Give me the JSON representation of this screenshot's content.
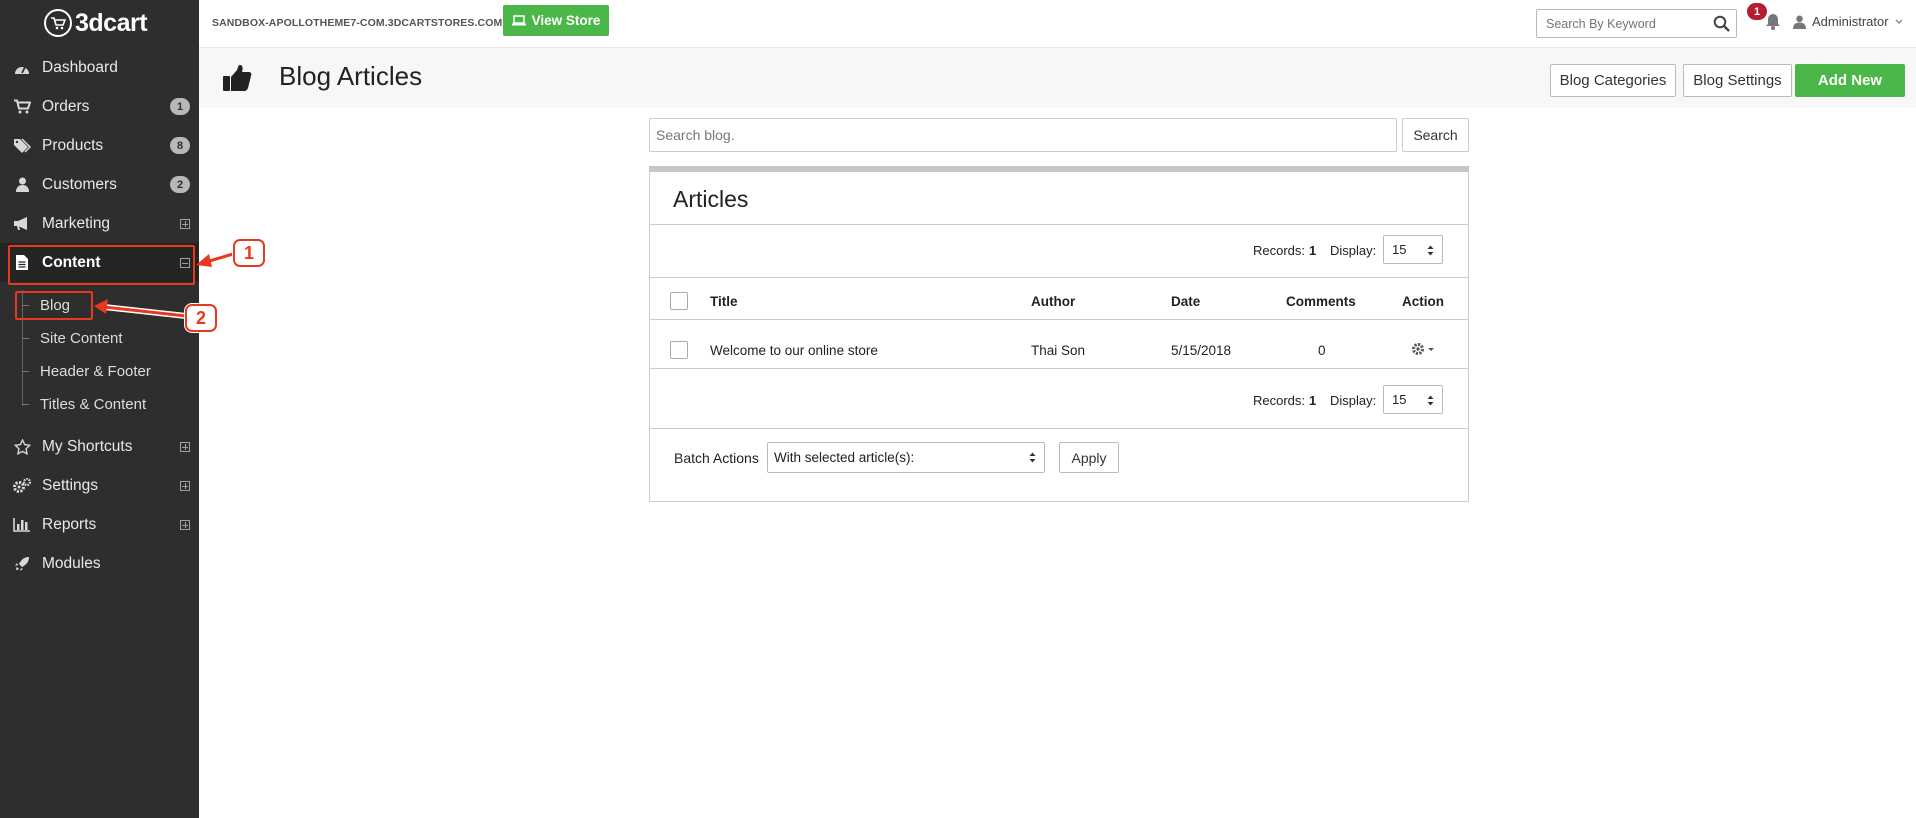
{
  "app": {
    "logo_text": "3dcart"
  },
  "sidebar": {
    "items": [
      {
        "label": "Dashboard",
        "icon": "dashboard-icon"
      },
      {
        "label": "Orders",
        "icon": "cart-icon",
        "badge": "1"
      },
      {
        "label": "Products",
        "icon": "tags-icon",
        "badge": "8"
      },
      {
        "label": "Customers",
        "icon": "user-icon",
        "badge": "2"
      },
      {
        "label": "Marketing",
        "icon": "bullhorn-icon"
      },
      {
        "label": "Content",
        "icon": "file-icon"
      },
      {
        "label": "My Shortcuts",
        "icon": "star-icon"
      },
      {
        "label": "Settings",
        "icon": "gears-icon"
      },
      {
        "label": "Reports",
        "icon": "bar-chart-icon"
      },
      {
        "label": "Modules",
        "icon": "rocket-icon"
      }
    ],
    "content_sub": [
      "Blog",
      "Site Content",
      "Header & Footer",
      "Titles & Content"
    ]
  },
  "annotations": {
    "callout_1": "1",
    "callout_2": "2",
    "accent": "#e8391e"
  },
  "topbar": {
    "store_url": "SANDBOX-APOLLOTHEME7-COM.3DCARTSTORES.COM",
    "view_store_label": "View Store",
    "search_placeholder": "Search By Keyword",
    "notification_count": "1",
    "user_label": "Administrator"
  },
  "header": {
    "title": "Blog Articles",
    "buttons": {
      "categories": "Blog Categories",
      "settings": "Blog Settings",
      "add_new": "Add New"
    }
  },
  "main": {
    "search_placeholder": "Search blog.",
    "search_button": "Search",
    "panel_title": "Articles",
    "records_label": "Records:",
    "records_count": "1",
    "display_label": "Display:",
    "display_value": "15",
    "columns": [
      "Title",
      "Author",
      "Date",
      "Comments",
      "Action"
    ],
    "rows": [
      {
        "title": "Welcome to our online store",
        "author": "Thai Son",
        "date": "5/15/2018",
        "comments": "0"
      }
    ],
    "batch_label": "Batch Actions",
    "batch_select": "With selected article(s):",
    "apply_label": "Apply"
  },
  "colors": {
    "sidebar_bg": "#2e2e2e",
    "green": "#4bb748",
    "badge_red": "#b31f2e"
  }
}
